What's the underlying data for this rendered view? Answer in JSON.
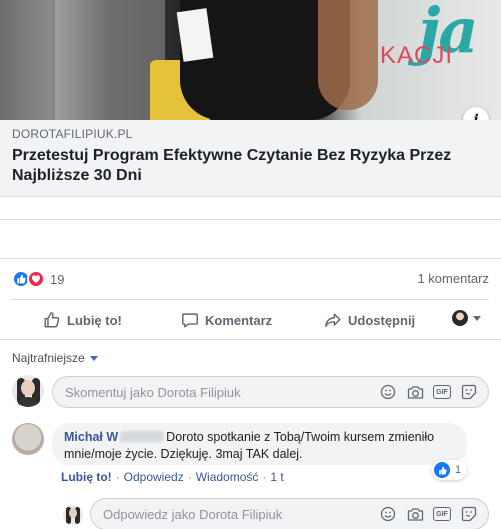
{
  "link_card": {
    "domain": "DOROTAFILIPIUK.PL",
    "headline": "Przetestuj Program Efektywne Czytanie Bez Ryzyka Przez Najbliższe 30 Dni",
    "info_icon": "info-icon",
    "image_brand_text_large": "ja",
    "image_brand_text_small": "KACJI"
  },
  "reactions": {
    "count": "19",
    "types": [
      "like",
      "love"
    ],
    "like_color": "#1877f2",
    "love_color": "#f0284a",
    "comments_summary": "1 komentarz"
  },
  "actions": {
    "like": "Lubię to!",
    "comment": "Komentarz",
    "share": "Udostępnij"
  },
  "sort": {
    "label": "Najtrafniejsze"
  },
  "composer": {
    "placeholder": "Skomentuj jako Dorota Filipiuk",
    "tools": [
      "emoji-icon",
      "camera-icon",
      "gif-icon",
      "sticker-icon"
    ],
    "gif_label": "GIF"
  },
  "comment": {
    "author": "Michał W",
    "text": "Doroto spotkanie z Tobą/Twoim kursem zmieniło mnie/moje życie. Dziękuję. 3maj TAK dalej.",
    "likes": "1",
    "like_action": "Lubię to!",
    "reply_action": "Odpowiedz",
    "message_action": "Wiadomość",
    "time": "1 t",
    "separator": "·"
  },
  "reply_composer": {
    "placeholder": "Odpowiedz jako Dorota Filipiuk"
  },
  "colors": {
    "link": "#385898",
    "muted": "#606770",
    "brand_teal": "#29a8a6",
    "brand_red": "#e0475b"
  }
}
